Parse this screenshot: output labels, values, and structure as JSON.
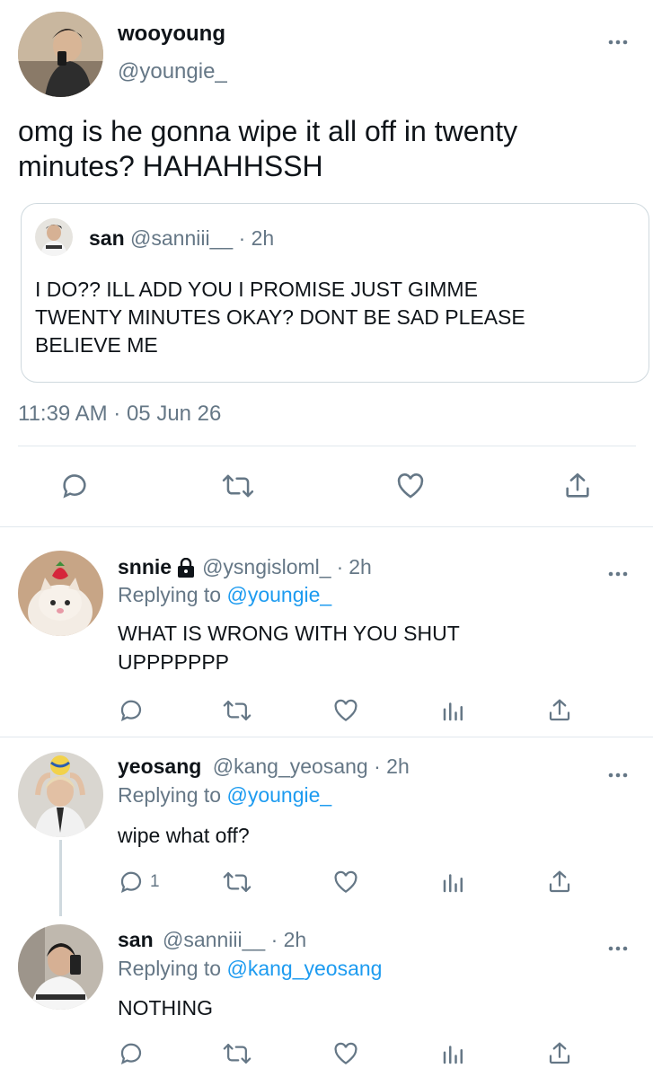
{
  "main_tweet": {
    "display_name": "wooyoung",
    "handle": "@youngie_",
    "more_icon": "more-horizontal-icon",
    "text_line1": "omg is he gonna wipe it all off in twenty",
    "text_line2": "minutes? HAHAHHSSH",
    "quoted": {
      "display_name": "san",
      "handle": "@sanniii__",
      "sep": "·",
      "time": "2h",
      "line1": "I DO?? ILL ADD YOU I PROMISE JUST GIMME",
      "line2": "TWENTY MINUTES OKAY? DONT BE SAD PLEASE",
      "line3": "BELIEVE ME"
    },
    "timestamp": "11:39 AM · 05 Jun 26",
    "actions": [
      "reply-icon",
      "retweet-icon",
      "like-icon",
      "share-icon"
    ]
  },
  "replies": [
    {
      "display_name": "snnie",
      "lock_icon": "lock-icon",
      "handle": "@ysngisloml_",
      "sep": "·",
      "time": "2h",
      "replying_prefix": "Replying to",
      "replying_to": "@youngie_",
      "line1": "WHAT IS WRONG WITH YOU SHUT",
      "line2": "UPPPPPPP",
      "reply_count": ""
    },
    {
      "display_name": "yeosang",
      "handle": "@kang_yeosang",
      "sep": "·",
      "time": "2h",
      "replying_prefix": "Replying to",
      "replying_to": "@youngie_",
      "line1": "wipe what off?",
      "reply_count": "1"
    },
    {
      "display_name": "san",
      "handle": "@sanniii__",
      "sep": "·",
      "time": "2h",
      "replying_prefix": "Replying to",
      "replying_to": "@kang_yeosang",
      "line1": "NOTHING",
      "reply_count": ""
    }
  ],
  "colors": {
    "link": "#1d9bf0",
    "muted": "#657786",
    "divider": "#e1e8ed"
  }
}
